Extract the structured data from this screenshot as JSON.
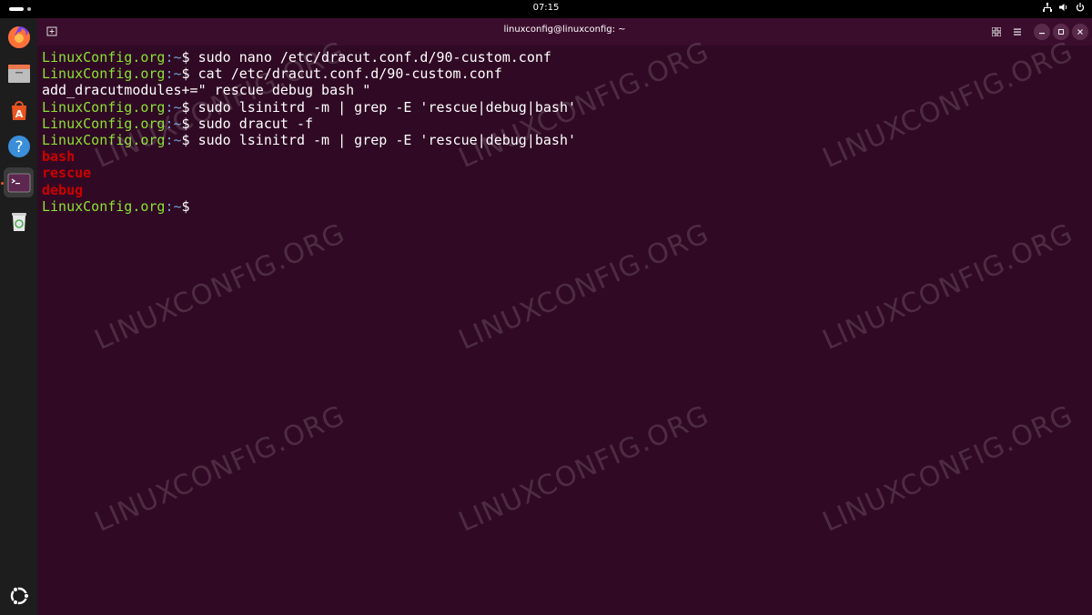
{
  "topbar": {
    "clock": "07:15",
    "tray_icons": [
      "network-icon",
      "volume-icon",
      "power-icon"
    ]
  },
  "dock": {
    "apps": [
      {
        "name": "firefox-icon",
        "active": false
      },
      {
        "name": "files-icon",
        "active": false
      },
      {
        "name": "app-center-icon",
        "active": false
      },
      {
        "name": "help-icon",
        "active": false
      },
      {
        "name": "terminal-icon",
        "active": true
      },
      {
        "name": "trash-icon",
        "active": false
      }
    ],
    "show_apps_icon": "ubuntu-logo-icon"
  },
  "window": {
    "title": "linuxconfig@linuxconfig: ~",
    "buttons": [
      "split-view-icon",
      "menu-icon",
      "minimize-icon",
      "maximize-icon",
      "close-icon"
    ]
  },
  "terminal": {
    "prompt_host": "LinuxConfig.org",
    "prompt_path": ":~",
    "prompt_sign": "$",
    "lines": [
      {
        "type": "cmd",
        "text": " sudo nano /etc/dracut.conf.d/90-custom.conf"
      },
      {
        "type": "cmd",
        "text": " cat /etc/dracut.conf.d/90-custom.conf"
      },
      {
        "type": "out",
        "text": "add_dracutmodules+=\" rescue debug bash \""
      },
      {
        "type": "cmd",
        "text": " sudo lsinitrd -m | grep -E 'rescue|debug|bash'"
      },
      {
        "type": "cmd",
        "text": " sudo dracut -f"
      },
      {
        "type": "cmd",
        "text": " sudo lsinitrd -m | grep -E 'rescue|debug|bash'"
      },
      {
        "type": "red",
        "text": "bash"
      },
      {
        "type": "red",
        "text": "rescue"
      },
      {
        "type": "red",
        "text": "debug"
      },
      {
        "type": "cmd",
        "text": ""
      }
    ]
  },
  "watermark": "LINUXCONFIG.ORG",
  "colors": {
    "terminal_bg": "#300a24",
    "prompt_green": "#8ae234",
    "path_blue": "#729fcf",
    "match_red": "#cc0000",
    "accent": "#e95420"
  }
}
